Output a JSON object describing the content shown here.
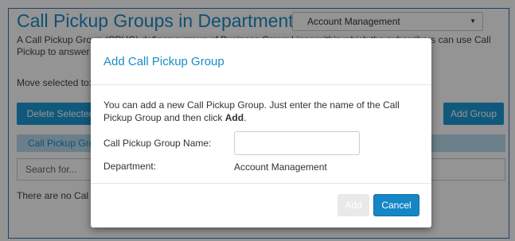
{
  "page": {
    "title": "Call Pickup Groups in Department:",
    "department_select": "Account Management",
    "description": "A Call Pickup Group (CPUG) defines a group of Business Group Lines within which the subscribers can use Call Pickup to answer",
    "move_label": "Move selected to:",
    "delete_button": "Delete Selected",
    "add_group_button": "Add Group",
    "tab_label": "Call Pickup Gro",
    "search_placeholder": "Search for...",
    "empty_text": "There are no Cal"
  },
  "modal": {
    "title": "Add Call Pickup Group",
    "body_text_prefix": "You can add a new Call Pickup Group. Just enter the name of the Call Pickup Group and then click ",
    "body_text_bold": "Add",
    "body_text_suffix": ".",
    "name_label": "Call Pickup Group Name:",
    "name_value": "",
    "department_label": "Department:",
    "department_value": "Account Management",
    "add_button": "Add",
    "cancel_button": "Cancel"
  },
  "colors": {
    "accent": "#1e9ad6",
    "title": "#1a8bc7",
    "cancel": "#1586c6",
    "disabled": "#e9e9e9"
  }
}
